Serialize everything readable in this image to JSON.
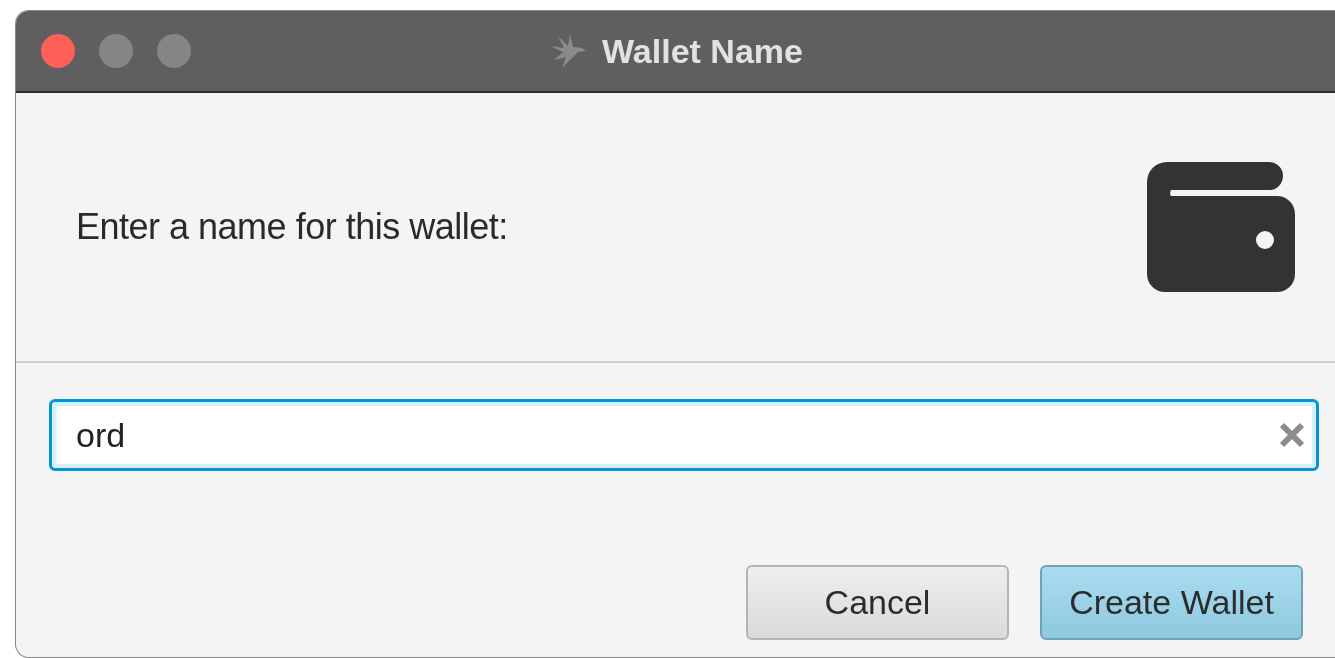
{
  "window": {
    "title": "Wallet Name"
  },
  "header": {
    "prompt": "Enter a name for this wallet:"
  },
  "name_field": {
    "value": "ord",
    "focused": true
  },
  "buttons": [
    {
      "label": "Cancel",
      "default": false
    },
    {
      "label": "Create Wallet",
      "default": true
    }
  ]
}
